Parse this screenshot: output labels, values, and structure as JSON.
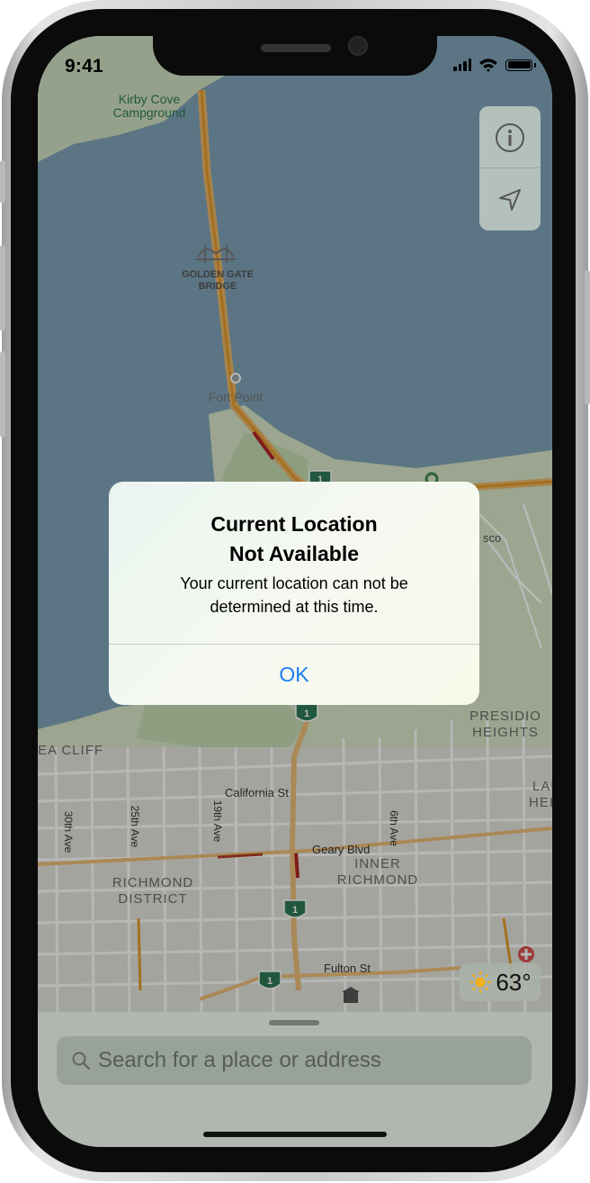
{
  "status_bar": {
    "time": "9:41"
  },
  "map": {
    "labels": {
      "kirby_cove": "Kirby Cove",
      "campground": "Campground",
      "golden_gate": "GOLDEN GATE",
      "bridge": "BRIDGE",
      "fort_point": "Fort Point",
      "sco": "sco",
      "presidio": "PRESIDIO",
      "heights": "HEIGHTS",
      "laur": "LAUR",
      "heigh": "HEIGH",
      "sea_cliff": "EA CLIFF",
      "california_st": "California St",
      "geary_blvd": "Geary Blvd",
      "ave_30th": "30th Ave",
      "ave_25th": "25th Ave",
      "ave_19th": "19th Ave",
      "ave_6th": "6th Ave",
      "inner": "INNER",
      "richmond_inner": "RICHMOND",
      "richmond": "RICHMOND",
      "district": "DISTRICT",
      "fulton_st": "Fulton St",
      "route_1": "1"
    },
    "weather": {
      "temperature": "63°",
      "icon": "sun-icon"
    },
    "controls": {
      "info_icon": "info-icon",
      "location_icon": "location-arrow-icon"
    }
  },
  "alert": {
    "title_line1": "Current Location",
    "title_line2": "Not Available",
    "message_line1": "Your current location can not be",
    "message_line2": "determined at this time.",
    "ok_label": "OK"
  },
  "search": {
    "placeholder": "Search for a place or address"
  },
  "colors": {
    "accent": "#1a7cf5",
    "water": "#7fa3b8",
    "land": "#d8e6c8",
    "highway": "#f0a830"
  }
}
